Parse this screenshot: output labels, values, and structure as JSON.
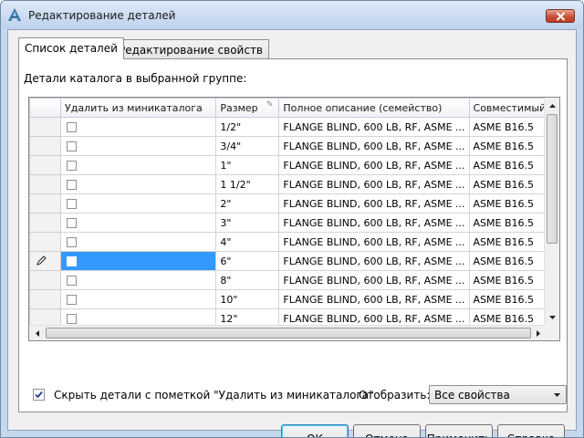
{
  "window": {
    "title": "Редактирование деталей"
  },
  "tabs": [
    {
      "label": "Список деталей",
      "active": true
    },
    {
      "label": "Редактирование свойств",
      "active": false
    }
  ],
  "group_label": "Детали каталога в выбранной группе:",
  "grid": {
    "columns": [
      {
        "label": ""
      },
      {
        "label": "Удалить из миникаталога"
      },
      {
        "label": "Размер",
        "edit_marker": "✎"
      },
      {
        "label": "Полное описание (семейство)"
      },
      {
        "label": "Совместимый"
      }
    ],
    "rows": [
      {
        "size": "1/2\"",
        "description": "FLANGE BLIND, 600 LB, RF, ASME ...",
        "compat": "ASME B16.5",
        "checked": false,
        "selected": false
      },
      {
        "size": "3/4\"",
        "description": "FLANGE BLIND, 600 LB, RF, ASME ...",
        "compat": "ASME B16.5",
        "checked": false,
        "selected": false
      },
      {
        "size": "1\"",
        "description": "FLANGE BLIND, 600 LB, RF, ASME ...",
        "compat": "ASME B16.5",
        "checked": false,
        "selected": false
      },
      {
        "size": "1 1/2\"",
        "description": "FLANGE BLIND, 600 LB, RF, ASME ...",
        "compat": "ASME B16.5",
        "checked": false,
        "selected": false
      },
      {
        "size": "2\"",
        "description": "FLANGE BLIND, 600 LB, RF, ASME ...",
        "compat": "ASME B16.5",
        "checked": false,
        "selected": false
      },
      {
        "size": "3\"",
        "description": "FLANGE BLIND, 600 LB, RF, ASME ...",
        "compat": "ASME B16.5",
        "checked": false,
        "selected": false
      },
      {
        "size": "4\"",
        "description": "FLANGE BLIND, 600 LB, RF, ASME ...",
        "compat": "ASME B16.5",
        "checked": false,
        "selected": false
      },
      {
        "size": "6\"",
        "description": "FLANGE BLIND, 600 LB, RF, ASME ...",
        "compat": "ASME B16.5",
        "checked": false,
        "selected": true
      },
      {
        "size": "8\"",
        "description": "FLANGE BLIND, 600 LB, RF, ASME ...",
        "compat": "ASME B16.5",
        "checked": false,
        "selected": false
      },
      {
        "size": "10\"",
        "description": "FLANGE BLIND, 600 LB, RF, ASME ...",
        "compat": "ASME B16.5",
        "checked": false,
        "selected": false
      },
      {
        "size": "12\"",
        "description": "FLANGE BLIND, 600 LB, RF, ASME ...",
        "compat": "ASME B16.5",
        "checked": false,
        "selected": false
      }
    ]
  },
  "hide_checkbox": {
    "label": "Скрыть детали с пометкой \"Удалить из миникаталога\"",
    "checked": true
  },
  "display": {
    "label": "Отобразить:",
    "selected": "Все свойства"
  },
  "buttons": {
    "ok": "ОК",
    "cancel": "Отмена",
    "apply": "Применить",
    "help": "Справка"
  },
  "colors": {
    "selection": "#3399ff",
    "title_bar": "#c5d8ee",
    "close_button": "#c8503a"
  },
  "icons": {
    "app": "autocad-icon",
    "close": "close-icon",
    "row_edit": "pencil-icon"
  }
}
